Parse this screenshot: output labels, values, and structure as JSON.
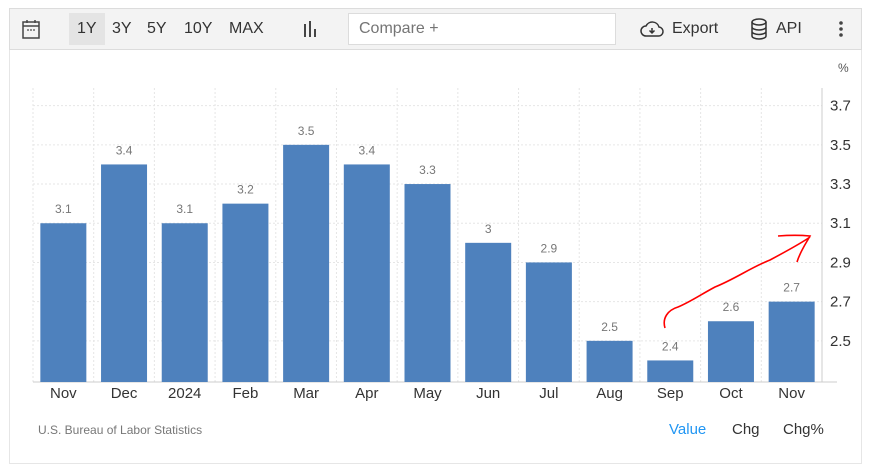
{
  "toolbar": {
    "ranges": [
      "1Y",
      "3Y",
      "5Y",
      "10Y",
      "MAX"
    ],
    "active_range": "1Y",
    "compare_placeholder": "Compare +",
    "export_label": "Export",
    "api_label": "API"
  },
  "source": "U.S. Bureau of Labor Statistics",
  "view_tabs": [
    "Value",
    "Chg",
    "Chg%"
  ],
  "active_view": "Value",
  "colors": {
    "bar": "#4e81bd",
    "accent": "#2196f3",
    "annotation": "#ff0000"
  },
  "chart_data": {
    "type": "bar",
    "unit_label": "%",
    "categories": [
      "Nov",
      "Dec",
      "2024",
      "Feb",
      "Mar",
      "Apr",
      "May",
      "Jun",
      "Jul",
      "Aug",
      "Sep",
      "Oct",
      "Nov"
    ],
    "values": [
      3.1,
      3.4,
      3.1,
      3.2,
      3.5,
      3.4,
      3.3,
      3,
      2.9,
      2.5,
      2.4,
      2.6,
      2.7
    ],
    "value_labels": [
      "3.1",
      "3.4",
      "3.1",
      "3.2",
      "3.5",
      "3.4",
      "3.3",
      "3",
      "2.9",
      "2.5",
      "2.4",
      "2.6",
      "2.7"
    ],
    "y_ticks": [
      "2.5",
      "2.7",
      "2.9",
      "3.1",
      "3.3",
      "3.5",
      "3.7"
    ],
    "ylim": [
      2.29,
      3.79
    ],
    "y_axis_position": "right",
    "grid": true,
    "annotation": "hand-drawn red upward arrow from Sep to Nov"
  }
}
